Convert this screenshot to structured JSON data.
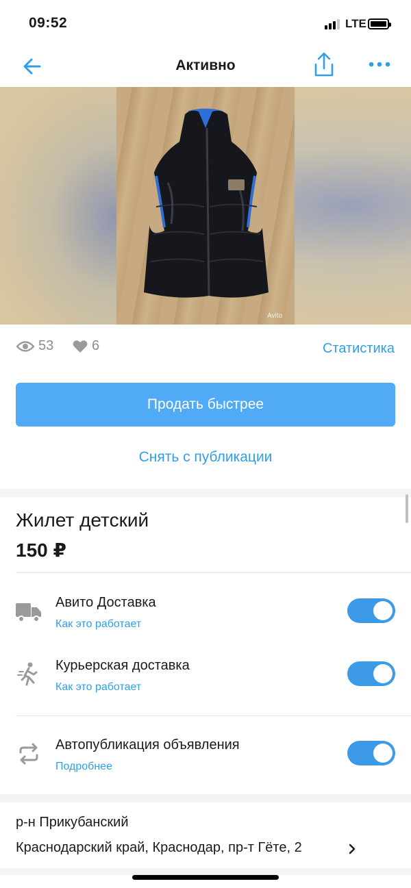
{
  "status_bar": {
    "time": "09:52",
    "network": "LTE"
  },
  "nav": {
    "title": "Активно",
    "back_icon": "arrow-left-icon",
    "share_icon": "share-icon",
    "more_icon": "more-dots-icon"
  },
  "photo": {
    "watermark": "Avito"
  },
  "stats": {
    "views": "53",
    "favorites": "6",
    "statistics_link": "Статистика"
  },
  "actions": {
    "sell_faster": "Продать быстрее",
    "unpublish": "Снять с публикации"
  },
  "listing": {
    "title": "Жилет детский",
    "price": "150 ₽"
  },
  "options": [
    {
      "title": "Авито Доставка",
      "link": "Как это работает",
      "icon": "truck-icon",
      "enabled": true
    },
    {
      "title": "Курьерская доставка",
      "link": "Как это работает",
      "icon": "courier-icon",
      "enabled": true
    },
    {
      "title": "Автопубликация объявления",
      "link": "Подробнее",
      "icon": "repeat-icon",
      "enabled": true
    }
  ],
  "location": {
    "district": "р-н Прикубанский",
    "address": "Краснодарский край, Краснодар, пр-т Гёте, 2"
  },
  "colors": {
    "accent": "#50aaf5",
    "link": "#2f9fe8",
    "toggle_on": "#3d9ae8"
  }
}
